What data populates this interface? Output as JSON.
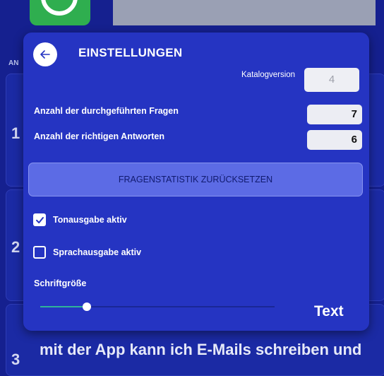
{
  "background": {
    "section_label": "AN",
    "card_numbers": [
      "1",
      "2",
      "3"
    ],
    "question_text": "mit der App kann ich E-Mails schreiben und"
  },
  "dialog": {
    "back_icon": "arrow-left-icon",
    "title": "EINSTELLUNGEN",
    "catalog_version": {
      "label": "Katalogversion",
      "value": "4"
    },
    "questions_done": {
      "label": "Anzahl der durchgeführten Fragen",
      "value": "7"
    },
    "correct_answers": {
      "label": "Anzahl der richtigen Antworten",
      "value": "6"
    },
    "reset_button": "FRAGENSTATISTIK ZURÜCKSETZEN",
    "sound_output": {
      "label": "Tonausgabe aktiv",
      "checked": true
    },
    "speech_output": {
      "label": "Sprachausgabe aktiv",
      "checked": false
    },
    "font_size": {
      "label": "Schriftgröße",
      "slider_fraction": 0.2,
      "preview": "Text"
    }
  },
  "colors": {
    "background": "#15208f",
    "dialog": "#2534c2",
    "button": "#5c6be5",
    "slider_active": "#2fb39a",
    "whatsapp_green": "#2fae4f"
  }
}
